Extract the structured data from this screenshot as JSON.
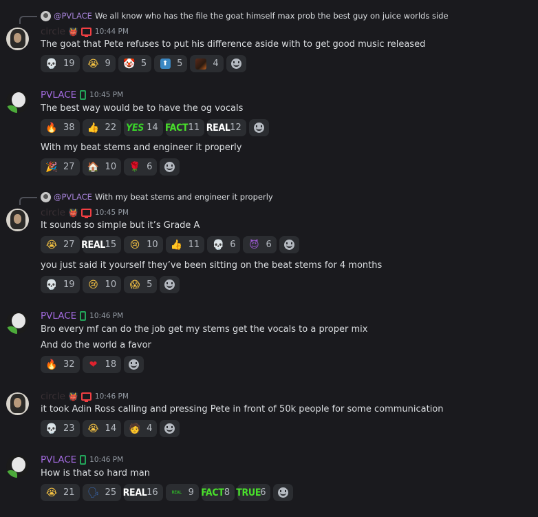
{
  "users": {
    "circle": {
      "name": "circle"
    },
    "pvlace": {
      "name": "PVLACE"
    }
  },
  "messages": [
    {
      "reply": {
        "name": "@PVLACE",
        "text": "We all know who has the file the goat himself max prob the best guy on juice worlds side"
      },
      "author": "circle",
      "time": "10:44 PM",
      "text": "The goat that Pete refuses to put his difference aside with to get good music released",
      "reactions": [
        {
          "emoji": "skull-icon",
          "glyph": "💀",
          "count": "19"
        },
        {
          "emoji": "sob-icon",
          "glyph": "😭",
          "count": "9"
        },
        {
          "emoji": "clown-icon",
          "glyph": "🤡",
          "count": "5"
        },
        {
          "emoji": "up-arrow-icon",
          "glyph": "⬆",
          "count": "5"
        },
        {
          "emoji": "custom-picture-icon",
          "glyph": "",
          "count": "4"
        }
      ]
    },
    {
      "author": "PVLACE",
      "time": "10:45 PM",
      "text": "The best way would be to have the og vocals",
      "reactions": [
        {
          "emoji": "fire-icon",
          "glyph": "🔥",
          "count": "38"
        },
        {
          "emoji": "thumbs-up-icon",
          "glyph": "👍",
          "count": "22"
        },
        {
          "emoji": "yes-text-icon",
          "glyph": "YES",
          "count": "14"
        },
        {
          "emoji": "fact-text-icon",
          "glyph": "FACT",
          "count": "11"
        },
        {
          "emoji": "real-text-icon",
          "glyph": "REAL",
          "count": "12"
        }
      ],
      "text2": "With my beat stems and engineer it properly",
      "reactions2": [
        {
          "emoji": "party-popper-icon",
          "glyph": "🎉",
          "count": "27"
        },
        {
          "emoji": "house-icon",
          "glyph": "🏠",
          "count": "10"
        },
        {
          "emoji": "rose-icon",
          "glyph": "🌹",
          "count": "6"
        }
      ]
    },
    {
      "reply": {
        "name": "@PVLACE",
        "text": "With my beat stems and engineer it properly"
      },
      "author": "circle",
      "time": "10:45 PM",
      "text": "It sounds so simple but it’s Grade A",
      "reactions": [
        {
          "emoji": "sob-icon",
          "glyph": "😭",
          "count": "27"
        },
        {
          "emoji": "real-text-icon",
          "glyph": "REAL",
          "count": "15"
        },
        {
          "emoji": "crying-icon",
          "glyph": "😢",
          "count": "10"
        },
        {
          "emoji": "thumbs-up-icon",
          "glyph": "👍",
          "count": "11"
        },
        {
          "emoji": "skull-icon",
          "glyph": "💀",
          "count": "6"
        },
        {
          "emoji": "purple-devil-icon",
          "glyph": "😈",
          "count": "6"
        }
      ],
      "text2": "you just said it yourself they’ve been sitting on the beat stems for 4 months",
      "reactions2": [
        {
          "emoji": "skull-icon",
          "glyph": "💀",
          "count": "19"
        },
        {
          "emoji": "crying-icon",
          "glyph": "😢",
          "count": "10"
        },
        {
          "emoji": "screaming-icon",
          "glyph": "😱",
          "count": "5"
        }
      ]
    },
    {
      "author": "PVLACE",
      "time": "10:46 PM",
      "text": "Bro every mf can do the job get my stems get the vocals to a proper mix",
      "text2": "And do the world a favor",
      "reactions2": [
        {
          "emoji": "fire-icon",
          "glyph": "🔥",
          "count": "32"
        },
        {
          "emoji": "heart-icon",
          "glyph": "❤",
          "count": "18"
        }
      ]
    },
    {
      "author": "circle",
      "time": "10:46 PM",
      "text": "it took Adin Ross calling and pressing Pete in front of 50k people for some communication",
      "reactions": [
        {
          "emoji": "skull-icon",
          "glyph": "💀",
          "count": "23"
        },
        {
          "emoji": "sob-icon",
          "glyph": "😭",
          "count": "14"
        },
        {
          "emoji": "person-at-computer-icon",
          "glyph": "🧑",
          "count": "4"
        }
      ]
    },
    {
      "author": "PVLACE",
      "time": "10:46 PM",
      "text": "How is that so hard man",
      "reactions": [
        {
          "emoji": "sob-icon",
          "glyph": "😭",
          "count": "21"
        },
        {
          "emoji": "speaking-head-icon",
          "glyph": "🗣",
          "count": "25"
        },
        {
          "emoji": "real-text-icon",
          "glyph": "REAL",
          "count": "16"
        },
        {
          "emoji": "green-text-icon",
          "glyph": "REAL",
          "count": "9"
        },
        {
          "emoji": "fact-text-icon",
          "glyph": "FACT",
          "count": "8"
        },
        {
          "emoji": "true-text-icon",
          "glyph": "TRUE",
          "count": "6"
        }
      ]
    }
  ]
}
